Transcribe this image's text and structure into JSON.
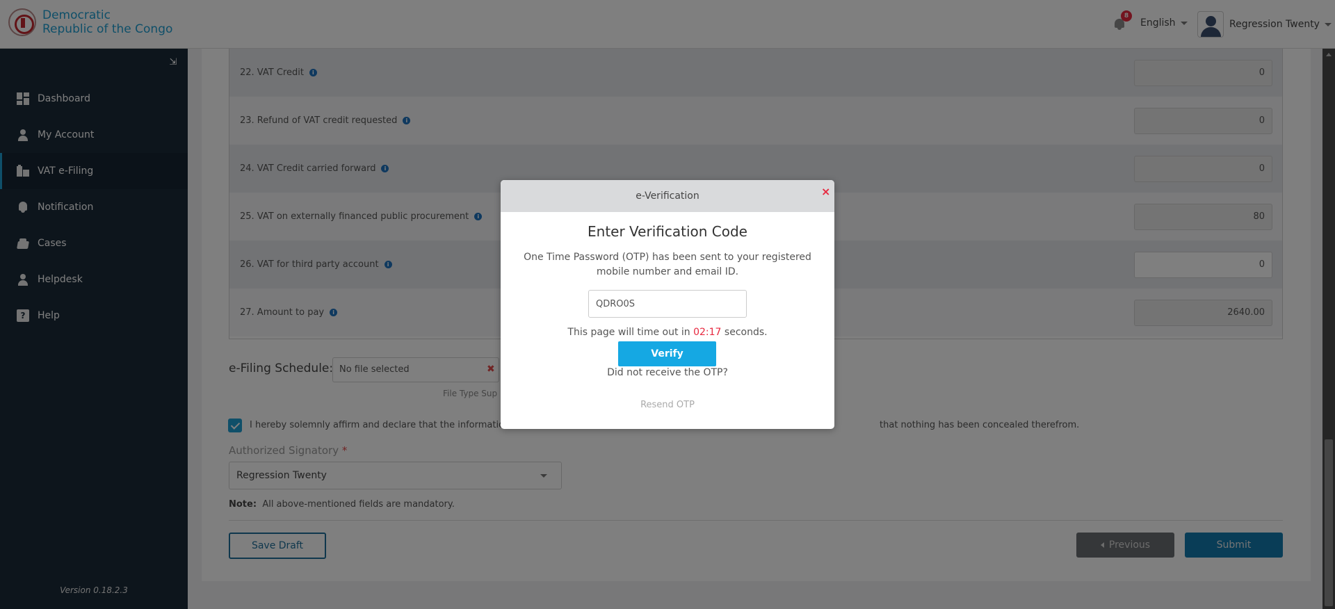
{
  "header": {
    "brand_line1": "Democratic",
    "brand_line2": "Republic of the Congo",
    "notification_count": "8",
    "language": "English",
    "user_name": "Regression Twenty"
  },
  "sidebar": {
    "items": [
      {
        "label": "Dashboard",
        "icon": "dashboard-icon"
      },
      {
        "label": "My Account",
        "icon": "user-icon"
      },
      {
        "label": "VAT e-Filing",
        "icon": "vat-filing-icon",
        "active": true
      },
      {
        "label": "Notification",
        "icon": "bell-icon"
      },
      {
        "label": "Cases",
        "icon": "cases-icon"
      },
      {
        "label": "Helpdesk",
        "icon": "helpdesk-icon"
      },
      {
        "label": "Help",
        "icon": "help-icon"
      }
    ],
    "version": "Version 0.18.2.3"
  },
  "form": {
    "rows": [
      {
        "label": "22. VAT Credit",
        "value": "0",
        "editable": false
      },
      {
        "label": "23. Refund of VAT credit requested",
        "value": "0",
        "editable": false
      },
      {
        "label": "24. VAT Credit carried forward",
        "value": "0",
        "editable": false
      },
      {
        "label": "25. VAT on externally financed public procurement",
        "value": "80",
        "editable": false
      },
      {
        "label": "26. VAT for third party account",
        "value": "0",
        "editable": true
      },
      {
        "label": "27. Amount to pay",
        "value": "2640.00",
        "editable": false
      }
    ],
    "schedule_label": "e-Filing Schedule:",
    "file_value": "No file selected",
    "file_type_text": "File Type Sup",
    "declaration_left": "I hereby solemnly affirm and declare that the informatio",
    "declaration_right": "that nothing has been concealed therefrom.",
    "signatory_label": "Authorized Signatory",
    "signatory_required": "*",
    "signatory_value": "Regression Twenty",
    "note_label": "Note:",
    "note_text": "All above-mentioned fields are mandatory.",
    "save_draft": "Save Draft",
    "previous": "Previous",
    "submit": "Submit"
  },
  "modal": {
    "header": "e-Verification",
    "close": "×",
    "title": "Enter Verification Code",
    "message": "One Time Password (OTP) has been sent to your registered mobile number and email ID.",
    "otp_value": "QDRO0S",
    "timeout_prefix": "This page will time out in",
    "timeout_time": "02:17",
    "timeout_suffix": "seconds.",
    "verify": "Verify",
    "no_otp": "Did not receive the OTP?",
    "resend": "Resend OTP"
  }
}
